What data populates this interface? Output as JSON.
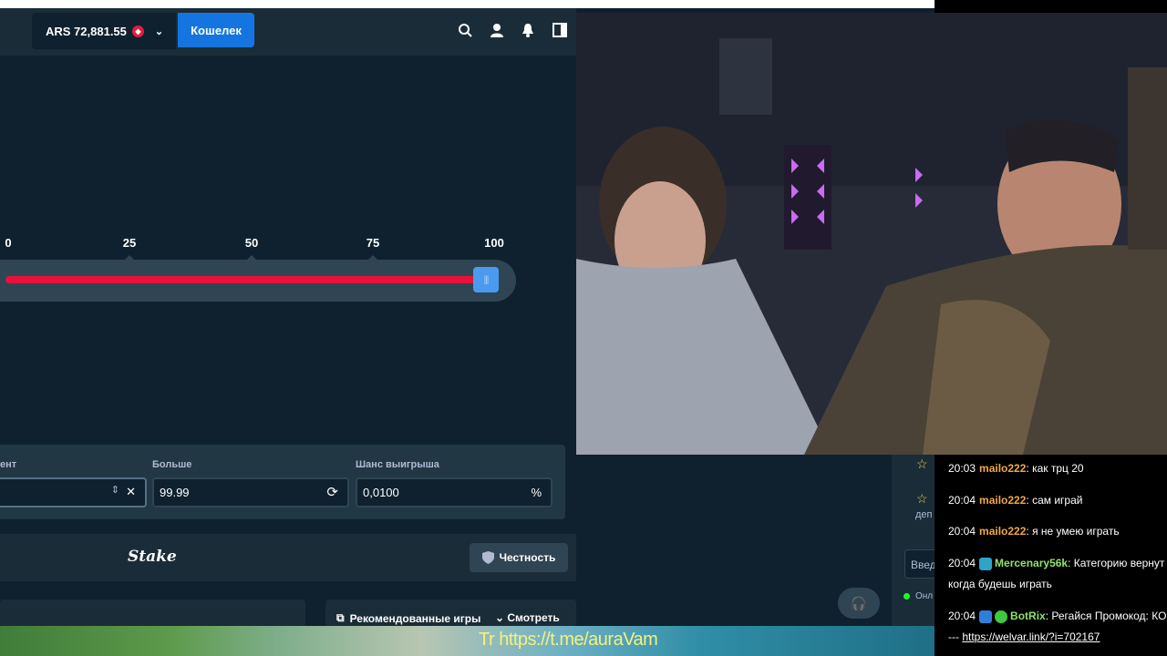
{
  "header": {
    "balance": "ARS 72,881.55",
    "wallet_label": "Кошелек",
    "icons": [
      "search-icon",
      "user-icon",
      "bell-icon",
      "sidebar-toggle-icon"
    ]
  },
  "slider": {
    "ticks": [
      "0",
      "25",
      "50",
      "75",
      "100"
    ],
    "value_percent": 99.99
  },
  "controls": {
    "multiplier_label_partial": "ент",
    "over_label": "Больше",
    "over_value": "99.99",
    "chance_label": "Шанс выигрыша",
    "chance_value": "0,0100",
    "chance_suffix": "%"
  },
  "footer": {
    "logo": "Stake",
    "fairness_label": "Честность"
  },
  "recommended": {
    "title": "Рекомендованные игры",
    "see_all": "Смотреть все"
  },
  "side_strip": {
    "text_dep": "деп",
    "text_input": "Введ",
    "text_online": "Онл"
  },
  "chat": {
    "messages": [
      {
        "time": "20:03",
        "user": "mailo222",
        "text": "как трц 20"
      },
      {
        "time": "20:04",
        "user": "mailo222",
        "text": "сам играй"
      },
      {
        "time": "20:04",
        "user": "mailo222",
        "text": "я не умею играть"
      },
      {
        "time": "20:04",
        "user": "Mercenary56k",
        "text": "Категорию вернут",
        "cont": "когда будешь играть"
      },
      {
        "time": "20:04",
        "user": "BotRix",
        "text": "Регайся Промокод: КО",
        "cont_prefix": "---",
        "link": "https://welvar.link/?i=702167"
      }
    ]
  },
  "banner": {
    "text": "Tr https://t.me/auraVam"
  },
  "colors": {
    "accent_blue": "#1475e1",
    "slider_red": "#e9113c",
    "handle_blue": "#4a9bf0",
    "bg_dark": "#0f212e",
    "panel": "#213743",
    "user_orange": "#f2a64a",
    "user_green": "#8ee26b"
  }
}
